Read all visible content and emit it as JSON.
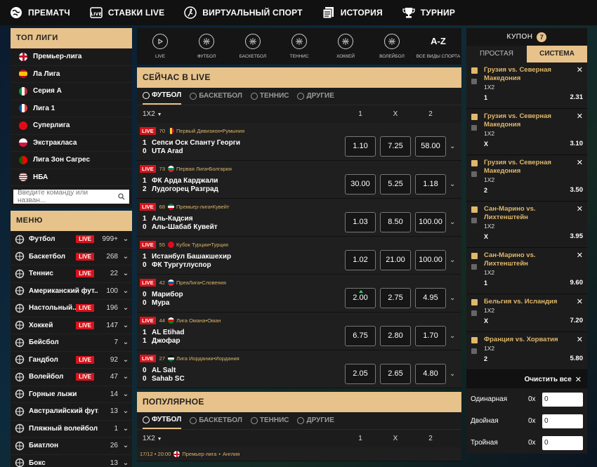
{
  "topnav": [
    {
      "label": "ПРЕМАТЧ",
      "icon": "globe-icon"
    },
    {
      "label": "СТАВКИ LIVE",
      "icon": "live-tv-icon"
    },
    {
      "label": "ВИРТУАЛЬНЫЙ СПОРТ",
      "icon": "runner-icon"
    },
    {
      "label": "ИСТОРИЯ",
      "icon": "history-icon"
    },
    {
      "label": "ТУРНИР",
      "icon": "trophy-icon"
    }
  ],
  "top_leagues": {
    "title": "ТОП ЛИГИ",
    "items": [
      {
        "label": "Премьер-лига",
        "flag": "england"
      },
      {
        "label": "Ла Лига",
        "flag": "spain"
      },
      {
        "label": "Серия А",
        "flag": "italy"
      },
      {
        "label": "Лига 1",
        "flag": "france"
      },
      {
        "label": "Суперлига",
        "flag": "turkey"
      },
      {
        "label": "Экстракласа",
        "flag": "poland"
      },
      {
        "label": "Лига Зон Сагрес",
        "flag": "portugal"
      },
      {
        "label": "НБА",
        "flag": "usa"
      }
    ],
    "search_placeholder": "Введите команду или назван..."
  },
  "menu": {
    "title": "МЕНЮ",
    "live_label": "LIVE",
    "items": [
      {
        "label": "Футбол",
        "live": true,
        "count": "999+",
        "icon": "football-icon"
      },
      {
        "label": "Баскетбол",
        "live": true,
        "count": "268",
        "icon": "basketball-icon"
      },
      {
        "label": "Теннис",
        "live": true,
        "count": "22",
        "icon": "tennis-icon"
      },
      {
        "label": "Американский фут...",
        "live": false,
        "count": "100",
        "icon": "american-football-icon"
      },
      {
        "label": "Настольный...",
        "live": true,
        "count": "196",
        "icon": "table-tennis-icon"
      },
      {
        "label": "Хоккей",
        "live": true,
        "count": "147",
        "icon": "hockey-icon"
      },
      {
        "label": "Бейсбол",
        "live": false,
        "count": "7",
        "icon": "baseball-icon"
      },
      {
        "label": "Гандбол",
        "live": true,
        "count": "92",
        "icon": "handball-icon"
      },
      {
        "label": "Волейбол",
        "live": true,
        "count": "47",
        "icon": "volleyball-icon"
      },
      {
        "label": "Горные лыжи",
        "live": false,
        "count": "14",
        "icon": "ski-icon"
      },
      {
        "label": "Австралийский фут...",
        "live": false,
        "count": "13",
        "icon": "aussie-rules-icon"
      },
      {
        "label": "Пляжный волейбол",
        "live": false,
        "count": "1",
        "icon": "beach-volleyball-icon"
      },
      {
        "label": "Биатлон",
        "live": false,
        "count": "26",
        "icon": "biathlon-icon"
      },
      {
        "label": "Бокс",
        "live": false,
        "count": "13",
        "icon": "boxing-icon"
      }
    ]
  },
  "sports_bar": [
    {
      "label": "LIVE",
      "icon": "play-icon"
    },
    {
      "label": "ФУТБОЛ",
      "icon": "football-icon"
    },
    {
      "label": "БАСКЕТБОЛ",
      "icon": "basketball-icon"
    },
    {
      "label": "ТЕННИС",
      "icon": "tennis-icon"
    },
    {
      "label": "ХОККЕЙ",
      "icon": "hockey-icon"
    },
    {
      "label": "ВОЛЕЙБОЛ",
      "icon": "volleyball-icon"
    },
    {
      "label": "ВСЕ ВИДЫ СПОРТА",
      "icon": "a-z-icon",
      "glyph": "A-Z"
    }
  ],
  "live_block": {
    "title": "СЕЙЧАС В LIVE",
    "tabs": [
      "ФУТБОЛ",
      "БАСКЕТБОЛ",
      "ТЕННИС",
      "ДРУГИЕ"
    ],
    "market": "1X2",
    "cols": [
      "1",
      "X",
      "2"
    ],
    "live_label": "LIVE",
    "matches": [
      {
        "minute": "70",
        "league": "Первый Дивизион",
        "country": "Румыния",
        "flag": "romania",
        "team1": "Сепси Оск Спанту Георги",
        "team2": "UTA Arad",
        "s1": "1",
        "s2": "0",
        "odds": [
          "1.10",
          "7.25",
          "58.00"
        ],
        "up": -1
      },
      {
        "minute": "73",
        "league": "Первая Лига",
        "country": "Болгария",
        "flag": "bulgaria",
        "team1": "ФК Арда Карджали",
        "team2": "Лудогорец Разград",
        "s1": "1",
        "s2": "2",
        "odds": [
          "30.00",
          "5.25",
          "1.18"
        ],
        "up": -1
      },
      {
        "minute": "68",
        "league": "Премьер-лига",
        "country": "Кувейт",
        "flag": "kuwait",
        "team1": "Аль-Кадсия",
        "team2": "Аль-Шабаб Кувейт",
        "s1": "1",
        "s2": "0",
        "odds": [
          "1.03",
          "8.50",
          "100.00"
        ],
        "up": -1
      },
      {
        "minute": "55",
        "league": "Кубок Турции",
        "country": "Турция",
        "flag": "turkey",
        "team1": "Истанбул Башакшехир",
        "team2": "ФК Тургутлуспор",
        "s1": "1",
        "s2": "0",
        "odds": [
          "1.02",
          "21.00",
          "100.00"
        ],
        "up": -1
      },
      {
        "minute": "42",
        "league": "ПреаЛига",
        "country": "Словения",
        "flag": "slovenia",
        "team1": "Марибор",
        "team2": "Мура",
        "s1": "0",
        "s2": "0",
        "odds": [
          "2.00",
          "2.75",
          "4.95"
        ],
        "up": 0
      },
      {
        "minute": "44",
        "league": "Лига Омана",
        "country": "Оман",
        "flag": "oman",
        "team1": "AL Etihad",
        "team2": "Джофар",
        "s1": "1",
        "s2": "1",
        "odds": [
          "6.75",
          "2.80",
          "1.70"
        ],
        "up": -1
      },
      {
        "minute": "27",
        "league": "Лига Иордании",
        "country": "Иордания",
        "flag": "jordan",
        "team1": "AL Salt",
        "team2": "Sahab SC",
        "s1": "0",
        "s2": "0",
        "odds": [
          "2.05",
          "2.65",
          "4.80"
        ],
        "up": -1
      }
    ]
  },
  "popular_block": {
    "title": "ПОПУЛЯРНОЕ",
    "tabs": [
      "ФУТБОЛ",
      "БАСКЕТБОЛ",
      "ТЕННИС",
      "ДРУГИЕ"
    ],
    "market": "1X2",
    "cols": [
      "1",
      "X",
      "2"
    ],
    "first_match_meta": "17/12 • 20:00",
    "first_match_league": "Премьер-лига",
    "first_match_country": "Англия"
  },
  "coupon": {
    "title": "КУПОН",
    "count": "7",
    "tabs": [
      "ПРОСТАЯ",
      "СИСТЕМА"
    ],
    "bets": [
      {
        "name": "Грузия vs. Северная Македония",
        "market": "1X2",
        "pick": "1",
        "odd": "2.31"
      },
      {
        "name": "Грузия vs. Северная Македония",
        "market": "1X2",
        "pick": "X",
        "odd": "3.10"
      },
      {
        "name": "Грузия vs. Северная Македония",
        "market": "1X2",
        "pick": "2",
        "odd": "3.50"
      },
      {
        "name": "Сан-Марино vs. Лихтенштейн",
        "market": "1X2",
        "pick": "X",
        "odd": "3.95"
      },
      {
        "name": "Сан-Марино vs. Лихтенштейн",
        "market": "1X2",
        "pick": "1",
        "odd": "9.60"
      },
      {
        "name": "Бельгия vs. Исландия",
        "market": "1X2",
        "pick": "X",
        "odd": "7.20"
      },
      {
        "name": "Франция vs. Хорватия",
        "market": "1X2",
        "pick": "2",
        "odd": "5.80"
      }
    ],
    "clear_all": "Очистить все",
    "stakes": [
      {
        "label": "Одинарная",
        "mult": "0x",
        "value": "0"
      },
      {
        "label": "Двойная",
        "mult": "0x",
        "value": "0"
      },
      {
        "label": "Тройная",
        "mult": "0x",
        "value": "0"
      }
    ]
  },
  "colors": {
    "accent": "#e7c28a",
    "live": "#d6141c",
    "panel": "#1c1c1c"
  }
}
